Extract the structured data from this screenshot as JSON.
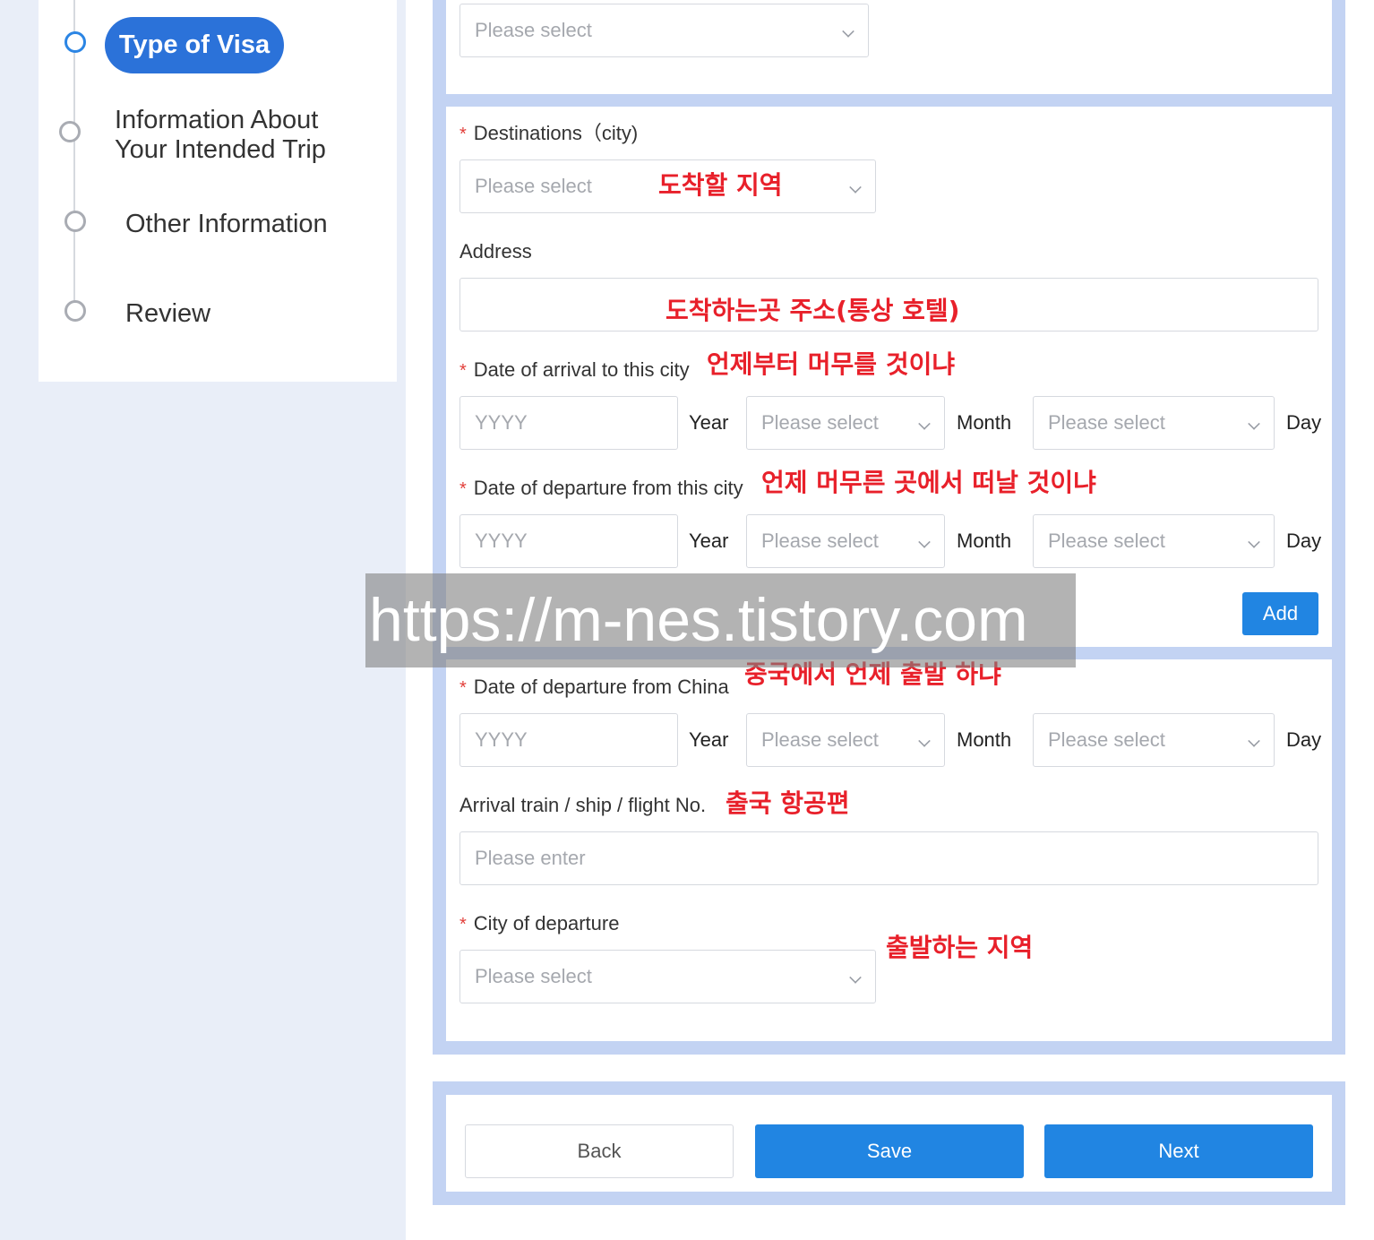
{
  "sidebar": {
    "steps": [
      {
        "label": "Type of Visa",
        "active": true
      },
      {
        "label_line1": "Information About",
        "label_line2": "Your Intended Trip"
      },
      {
        "label": "Other Information"
      },
      {
        "label": "Review"
      }
    ]
  },
  "top_select": {
    "placeholder": "Please select"
  },
  "destinations": {
    "label": "Destinations（city)",
    "placeholder": "Please select",
    "note": "도착할 지역"
  },
  "address": {
    "label": "Address",
    "value": "",
    "note": "도착하는곳 주소(통상 호텔)"
  },
  "arrival_date": {
    "label": "Date of arrival to this city",
    "note": "언제부터 머무를 것이냐",
    "year_placeholder": "YYYY",
    "year_unit": "Year",
    "month_placeholder": "Please select",
    "month_unit": "Month",
    "day_placeholder": "Please select",
    "day_unit": "Day"
  },
  "departure_city_date": {
    "label": "Date of departure from this city",
    "note": "언제 머무른 곳에서 떠날 것이냐",
    "year_placeholder": "YYYY",
    "year_unit": "Year",
    "month_placeholder": "Please select",
    "month_unit": "Month",
    "day_placeholder": "Please select",
    "day_unit": "Day"
  },
  "add_button": "Add",
  "watermark": "https://m-nes.tistory.com",
  "departure_china": {
    "label": "Date of departure from China",
    "note": "중국에서 언제 출발 하냐",
    "year_placeholder": "YYYY",
    "year_unit": "Year",
    "month_placeholder": "Please select",
    "month_unit": "Month",
    "day_placeholder": "Please select",
    "day_unit": "Day"
  },
  "flight": {
    "label": "Arrival train / ship / flight No.",
    "note": "출국 항공편",
    "placeholder": "Please enter"
  },
  "city_departure": {
    "label": "City of departure",
    "placeholder": "Please select",
    "note": "출발하는 지역"
  },
  "footer": {
    "back": "Back",
    "save": "Save",
    "next": "Next"
  }
}
